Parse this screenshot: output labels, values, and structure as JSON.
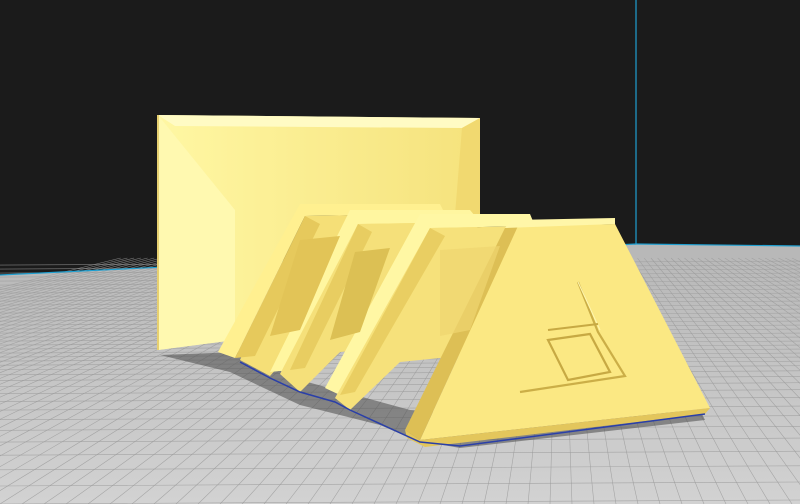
{
  "app": {
    "view": "3d-slicer-viewport",
    "model": "stacked-trapezoid-stand"
  },
  "colors": {
    "background": "#1b1b1b",
    "plate_light": "#c9c9c9",
    "plate_dark": "#a9a9a9",
    "grid_line": "#9a9a9a",
    "axis_line": "#1f9fd0",
    "model_light": "#fff49a",
    "model_mid": "#f6e27b",
    "model_dark": "#e0c45b",
    "model_shadow": "#c9a93f",
    "model_outline": "#2a3fa8",
    "drop_shadow": "#555555"
  }
}
